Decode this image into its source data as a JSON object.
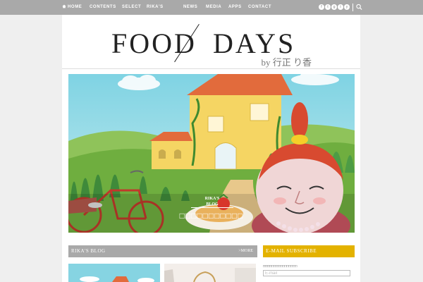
{
  "nav": {
    "items": [
      {
        "label": "HOME"
      },
      {
        "label": "CONTENTS"
      },
      {
        "label": "SELECT"
      },
      {
        "label": "RIKA'S"
      },
      {
        "label": "NEWS"
      },
      {
        "label": "MEDIA"
      },
      {
        "label": "APPS"
      },
      {
        "label": "CONTACT"
      }
    ],
    "social": [
      "f",
      "t",
      "g",
      "i",
      "y"
    ]
  },
  "logo": {
    "word1": "FOOD",
    "word2": "DAYS",
    "byline": "by 行正 り香"
  },
  "hero": {
    "tag_line1": "RIKA'S",
    "tag_line2": "BLOG",
    "title": "□□□□□□□□□□□"
  },
  "blog_section": {
    "title": "RIKA'S BLOG",
    "more": ">MORE"
  },
  "subscribe": {
    "title": "E-MAIL SUBSCRIBE",
    "label": "□□□□□□□□□□□□□□□□",
    "placeholder": "E-mail"
  },
  "colors": {
    "nav_bg": "#a9a9a9",
    "subscribe_accent": "#e3b200"
  }
}
